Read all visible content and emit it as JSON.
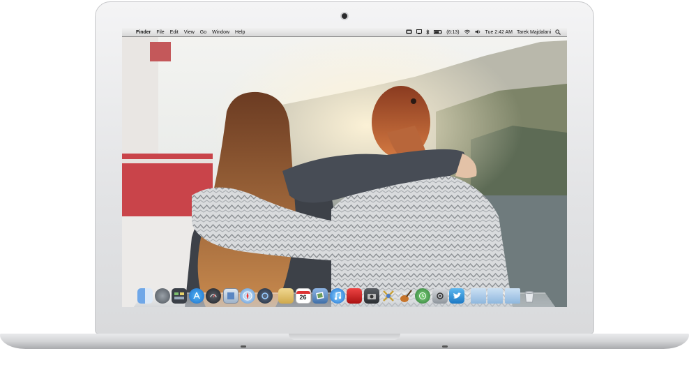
{
  "menubar": {
    "apple_glyph": "",
    "app_name": "Finder",
    "menus": [
      "File",
      "Edit",
      "View",
      "Go",
      "Window",
      "Help"
    ],
    "battery": "(6:13)",
    "clock": "Tue 2:42 AM",
    "user": "Tarek Majdalani"
  },
  "dock": {
    "calendar_day": "26",
    "items": [
      "finder-icon",
      "launchpad-icon",
      "mission-control-icon",
      "app-store-icon",
      "dashboard-icon",
      "preview-icon",
      "safari-icon",
      "quicktime-icon",
      "notes-icon",
      "calendar-icon",
      "iphoto-icon",
      "itunes-icon",
      "photo-booth-icon",
      "image-capture-icon",
      "xcode-tools-icon",
      "garageband-icon",
      "time-machine-icon",
      "utility-icon",
      "twitter-icon",
      "applications-folder-icon",
      "documents-folder-icon",
      "downloads-folder-icon",
      "trash-icon"
    ]
  },
  "colors": {
    "menubar": "#e4e4e4",
    "dock_glass": "#c9ced3",
    "laptop_aluminum": "#e2e3e5"
  }
}
